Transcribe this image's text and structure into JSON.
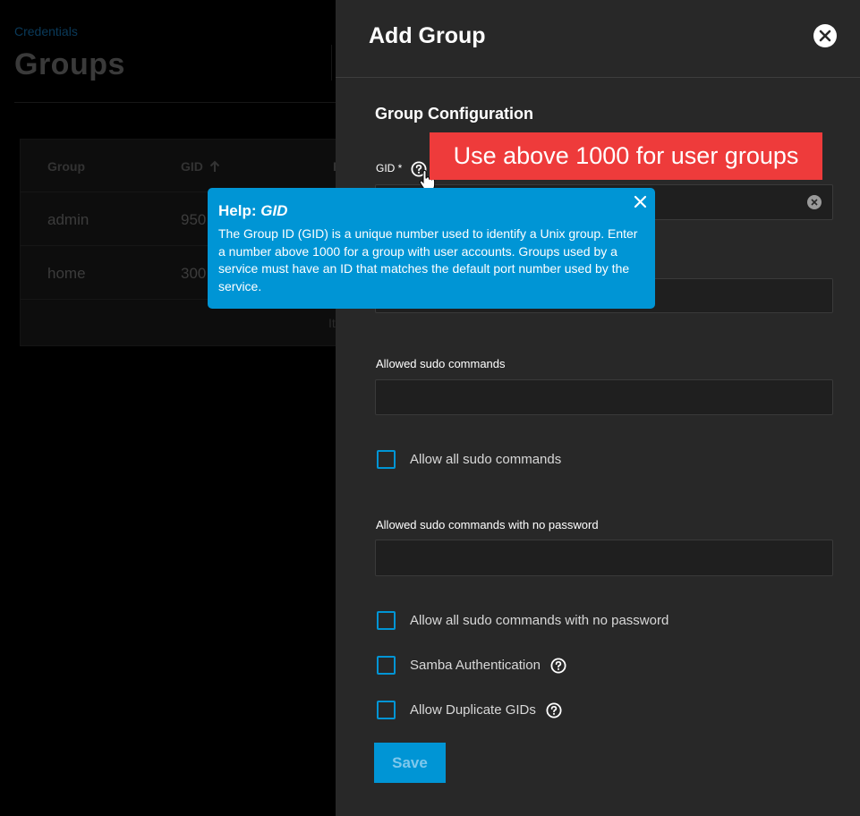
{
  "background": {
    "breadcrumb": "Credentials",
    "title": "Groups",
    "table": {
      "headers": [
        "Group",
        "GID",
        "B"
      ],
      "rows": [
        {
          "group": "admin",
          "gid": "950"
        },
        {
          "group": "home",
          "gid": "300"
        }
      ],
      "footer_fragment": "It"
    }
  },
  "panel": {
    "title": "Add Group",
    "section_title": "Group Configuration",
    "gid_label": "GID *",
    "fields": {
      "allowed_sudo_label": "Allowed sudo commands",
      "allowed_sudo_nopass_label": "Allowed sudo commands with no password"
    },
    "checkboxes": {
      "allow_all_sudo": "Allow all sudo commands",
      "allow_all_sudo_nopass": "Allow all sudo commands with no password",
      "samba_auth": "Samba Authentication",
      "allow_duplicate_gids": "Allow Duplicate GIDs"
    },
    "save_label": "Save"
  },
  "callout": "Use above 1000 for user groups",
  "help": {
    "prefix": "Help: ",
    "field": "GID",
    "body": "The Group ID (GID) is a unique number used to identify a Unix group. Enter a number above 1000 for a group with user accounts. Groups used by a service must have an ID that matches the default port number used by the service."
  },
  "colors": {
    "accent": "#0095d5",
    "callout": "#ee3b3b",
    "panel_bg": "#282828"
  },
  "icons": {
    "close": "close-icon",
    "help": "help-circle-icon",
    "clear": "clear-icon",
    "sort": "arrow-up-icon",
    "cursor": "hand-pointer-icon"
  }
}
